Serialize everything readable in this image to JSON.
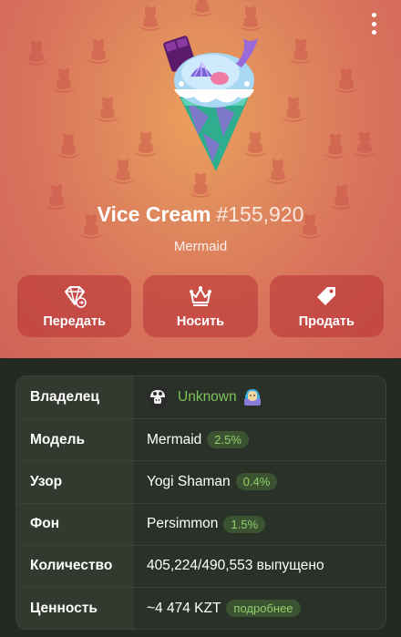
{
  "header": {
    "gift_name": "Vice Cream",
    "gift_number": "#155,920",
    "subtitle": "Mermaid",
    "more_icon": "more-vertical-icon"
  },
  "colors": {
    "hero": "#d9735c",
    "accent_green": "#7dc35b",
    "badge_bg": "#3c5332"
  },
  "actions": [
    {
      "label": "Передать",
      "icon": "transfer-gem-icon"
    },
    {
      "label": "Носить",
      "icon": "crown-icon"
    },
    {
      "label": "Продать",
      "icon": "price-tag-icon"
    }
  ],
  "details": {
    "owner": {
      "label": "Владелец",
      "value": "Unknown",
      "avatar": "mushroom-avatar",
      "emoji": "dj-animal-sticker"
    },
    "model": {
      "label": "Модель",
      "value": "Mermaid",
      "percent": "2.5%"
    },
    "pattern": {
      "label": "Узор",
      "value": "Yogi Shaman",
      "percent": "0.4%"
    },
    "backdrop": {
      "label": "Фон",
      "value": "Persimmon",
      "percent": "1.5%"
    },
    "quantity": {
      "label": "Количество",
      "value": "405,224/490,553 выпущено"
    },
    "value": {
      "label": "Ценность",
      "value": "~4 474 KZT",
      "link": "подробнее"
    }
  }
}
